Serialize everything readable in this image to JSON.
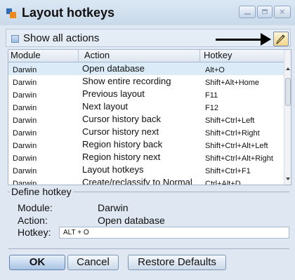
{
  "window": {
    "title": "Layout hotkeys",
    "close_glyph": "×"
  },
  "toolbar": {
    "show_all_label": "Show all actions",
    "show_all_checked": false,
    "edit_icon": "pencil-icon"
  },
  "table": {
    "columns": [
      "Module",
      "Action",
      "Hotkey"
    ],
    "rows": [
      {
        "module": "Darwin",
        "action": "Open database",
        "hotkey": "Alt+O"
      },
      {
        "module": "Darwin",
        "action": "Show entire recording",
        "hotkey": "Shift+Alt+Home"
      },
      {
        "module": "Darwin",
        "action": "Previous layout",
        "hotkey": "F11"
      },
      {
        "module": "Darwin",
        "action": "Next layout",
        "hotkey": "F12"
      },
      {
        "module": "Darwin",
        "action": "Cursor history back",
        "hotkey": "Shift+Ctrl+Left"
      },
      {
        "module": "Darwin",
        "action": "Cursor history next",
        "hotkey": "Shift+Ctrl+Right"
      },
      {
        "module": "Darwin",
        "action": "Region history back",
        "hotkey": "Shift+Ctrl+Alt+Left"
      },
      {
        "module": "Darwin",
        "action": "Region history next",
        "hotkey": "Shift+Ctrl+Alt+Right"
      },
      {
        "module": "Darwin",
        "action": "Layout hotkeys",
        "hotkey": "Shift+Ctrl+F1"
      },
      {
        "module": "Darwin",
        "action": "Create/reclassify to Normal",
        "hotkey": "Ctrl+Alt+D"
      }
    ]
  },
  "define": {
    "legend": "Define hotkey",
    "module_label": "Module:",
    "module_value": "Darwin",
    "action_label": "Action:",
    "action_value": "Open database",
    "hotkey_label": "Hotkey:",
    "hotkey_value": "ALT + O"
  },
  "buttons": {
    "ok": "OK",
    "cancel": "Cancel",
    "restore": "Restore Defaults"
  }
}
